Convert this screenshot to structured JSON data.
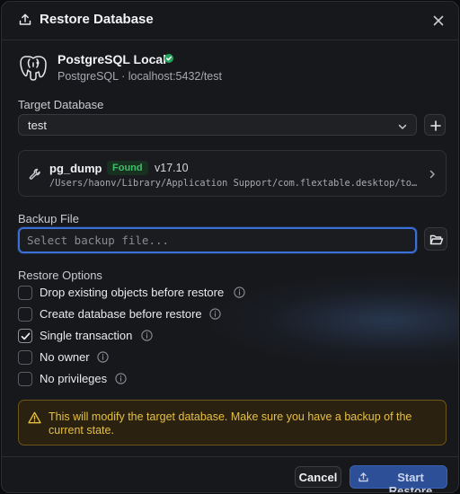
{
  "dialog": {
    "title": "Restore Database",
    "icons": {
      "title": "upload-icon",
      "close": "close-icon"
    }
  },
  "connection": {
    "name": "PostgreSQL Local",
    "subtitle": "PostgreSQL · localhost:5432/test",
    "status_color": "#22a35a",
    "icons": {
      "logo": "postgresql-elephant-icon",
      "status": "check-circle-icon"
    }
  },
  "target_database": {
    "label": "Target Database",
    "selected": "test",
    "icons": {
      "dropdown": "chevron-down-icon",
      "add": "plus-icon"
    }
  },
  "tool": {
    "name": "pg_dump",
    "status": "Found",
    "version": "v17.10",
    "path": "/Users/haonv/Library/Application Support/com.flextable.desktop/tool…",
    "icons": {
      "tool": "wrench-icon",
      "open": "chevron-right-icon"
    }
  },
  "backup_file": {
    "label": "Backup File",
    "value": "",
    "placeholder": "Select backup file...",
    "icons": {
      "browse": "folder-open-icon"
    }
  },
  "restore_options": {
    "label": "Restore Options",
    "items": [
      {
        "label": "Drop existing objects before restore",
        "checked": false
      },
      {
        "label": "Create database before restore",
        "checked": false
      },
      {
        "label": "Single transaction",
        "checked": true
      },
      {
        "label": "No owner",
        "checked": false
      },
      {
        "label": "No privileges",
        "checked": false
      }
    ],
    "icons": {
      "info": "info-icon",
      "check": "checkmark-icon"
    }
  },
  "warning": {
    "text": "This will modify the target database. Make sure you have a backup of the current state.",
    "color": "#e5c042",
    "icon": "warning-triangle-icon"
  },
  "footer": {
    "cancel_label": "Cancel",
    "start_label": "Start Restore",
    "start_icon": "upload-icon",
    "accent": "#2c4f97"
  }
}
